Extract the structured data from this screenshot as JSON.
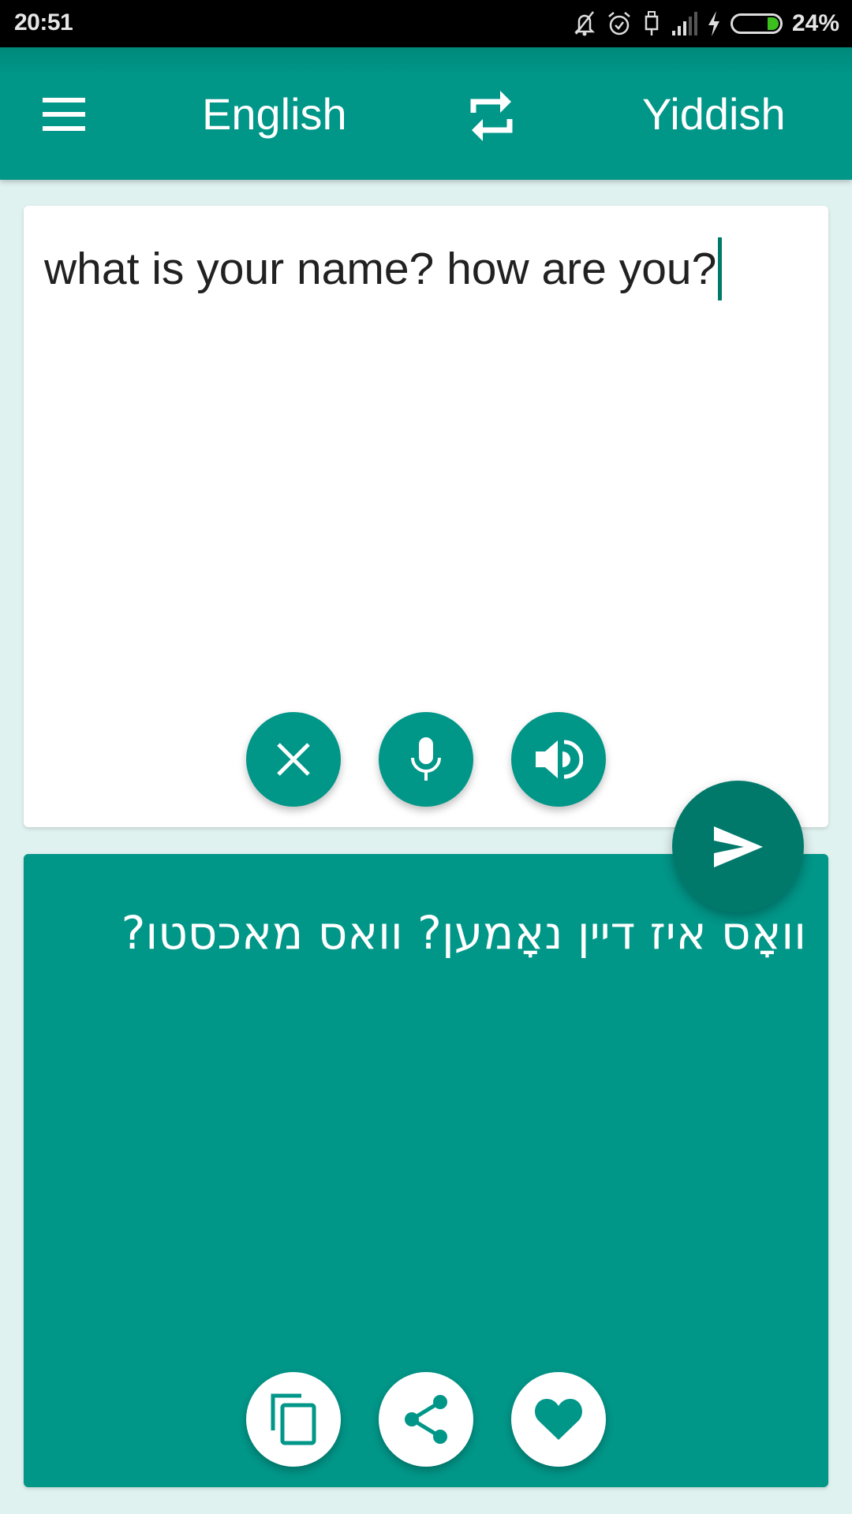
{
  "status_bar": {
    "time": "20:51",
    "battery_percent": "24%",
    "battery_level": 0.24,
    "icons": [
      "notifications-off-icon",
      "alarm-icon",
      "usb-icon",
      "signal-icon",
      "charging-icon",
      "battery-icon"
    ]
  },
  "app_bar": {
    "menu_icon": "hamburger-menu-icon",
    "source_language": "English",
    "swap_icon": "swap-languages-icon",
    "target_language": "Yiddish"
  },
  "input_card": {
    "text": "what is your name? how are you?",
    "buttons": [
      {
        "name": "clear",
        "icon": "close-icon"
      },
      {
        "name": "voice-input",
        "icon": "microphone-icon"
      },
      {
        "name": "speak",
        "icon": "speaker-icon"
      }
    ]
  },
  "translate_fab": {
    "icon": "send-icon"
  },
  "output_card": {
    "text": "וואָס איז דיין נאָמען? וואס מאכסטו?",
    "buttons": [
      {
        "name": "copy",
        "icon": "copy-icon"
      },
      {
        "name": "share",
        "icon": "share-icon"
      },
      {
        "name": "favorite",
        "icon": "heart-icon"
      }
    ]
  },
  "colors": {
    "primary": "#009688",
    "primary_dark": "#00796b",
    "background": "#e0f2f0",
    "battery_fill": "#3dc01e"
  }
}
